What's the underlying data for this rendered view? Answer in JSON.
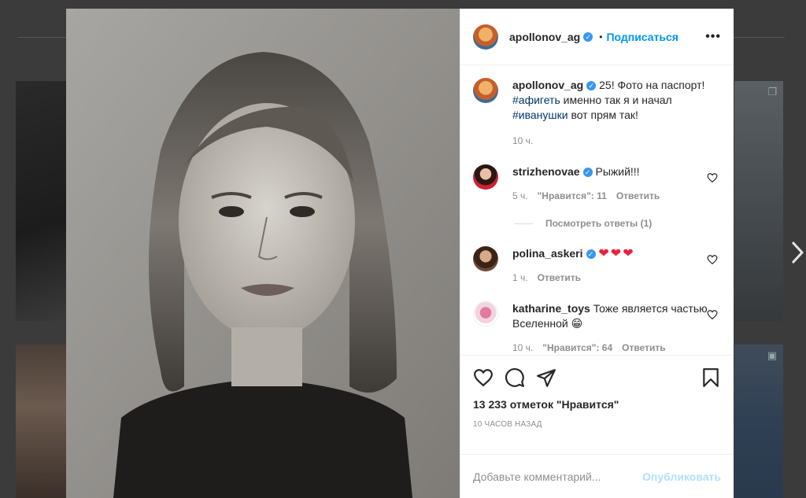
{
  "post": {
    "author": "apollonov_ag",
    "verified": true,
    "follow_label": "Подписаться",
    "dot": "•",
    "more_label": "•••",
    "caption_text": "25! Фото на паспорт!",
    "caption_tag1": "#афигеть",
    "caption_mid": " именно так я и начал",
    "caption_tag2": "#иванушки",
    "caption_end": " вот прям так!",
    "caption_time": "10 ч.",
    "likes_label": "13 233 отметок \"Нравится\"",
    "timestamp": "10 часов назад"
  },
  "comments": [
    {
      "user": "strizhenovae",
      "text": "Рыжий!!!",
      "time": "5 ч.",
      "likes": "\"Нравится\": 11",
      "reply": "Ответить",
      "view_replies": "Посмотреть ответы (1)"
    },
    {
      "user": "polina_askeri",
      "text": "❤❤❤",
      "time": "1 ч.",
      "reply": "Ответить"
    },
    {
      "user": "katharine_toys",
      "text": "Тоже является частью Вселенной 😁",
      "time": "10 ч.",
      "likes": "\"Нравится\": 64",
      "reply": "Ответить"
    }
  ],
  "composer": {
    "placeholder": "Добавьте комментарий...",
    "publish_label": "Опубликовать"
  },
  "icons": {
    "next": "chevron-right-icon",
    "like": "heart-icon",
    "comment": "comment-bubble-icon",
    "share": "paper-plane-icon",
    "save": "bookmark-icon"
  },
  "colors": {
    "accent": "#0095f6",
    "verified": "#3897f0",
    "hashtag": "#00376b",
    "publish_disabled": "#b2dffc",
    "heart_red": "#ed1f3b"
  }
}
